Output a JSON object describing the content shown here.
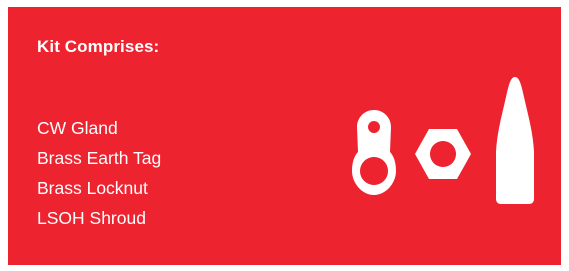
{
  "kit": {
    "heading": "Kit Comprises:",
    "items": [
      "CW Gland",
      "Brass Earth Tag",
      "Brass Locknut",
      "LSOH Shroud"
    ]
  },
  "icons": [
    "earth-tag-icon",
    "locknut-icon",
    "shroud-icon"
  ],
  "colors": {
    "panel_background": "#ee2330",
    "text": "#ffffff",
    "icon": "#ffffff"
  }
}
